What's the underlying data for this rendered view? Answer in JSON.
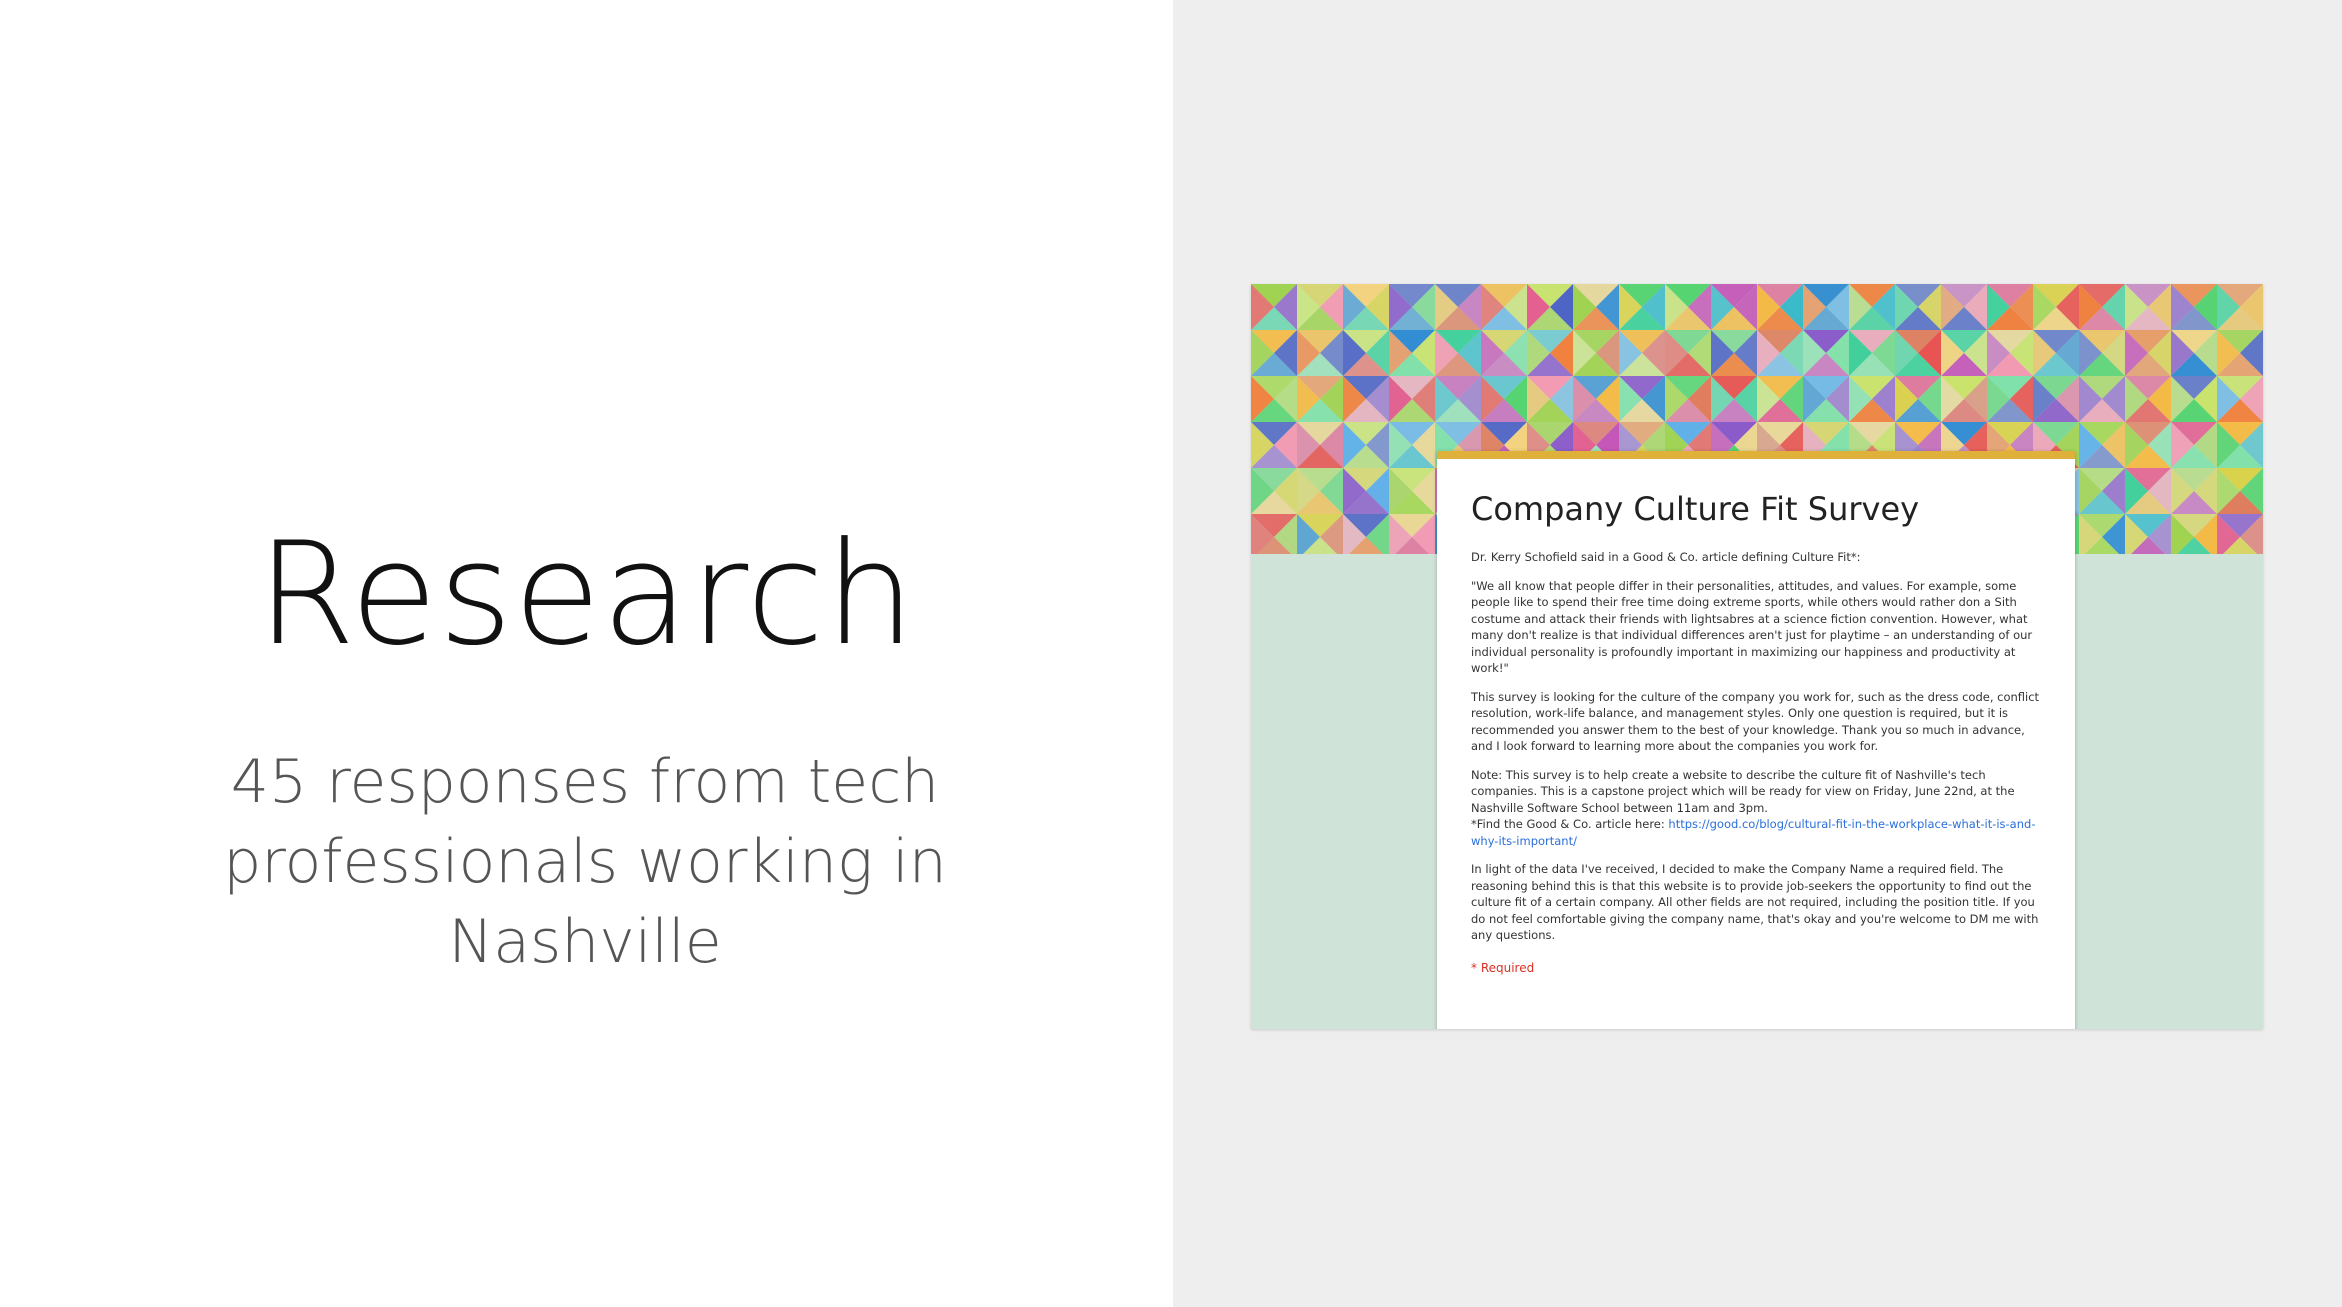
{
  "slide": {
    "title": "Research",
    "subtitle": "45 responses from tech professionals working in Nashville"
  },
  "form": {
    "title": "Company Culture Fit Survey",
    "intro": "Dr. Kerry Schofield said in a Good & Co. article defining Culture Fit*:",
    "quote": "\"We all know that people differ in their personalities, attitudes, and values. For example, some people like to spend their free time doing extreme sports, while others would rather don a Sith costume and attack their friends with lightsabres at a science fiction convention. However, what many don't realize is that individual differences aren't just for playtime – an understanding of our individual personality is profoundly important in maximizing our happiness and productivity at work!\"",
    "description": "This survey is looking for the culture of the company you work for, such as the dress code, conflict resolution, work-life balance, and management styles. Only one question is required, but it is recommended you answer them to the best of your knowledge. Thank you so much in advance, and I look forward to learning more about the companies you work for.",
    "note": "Note: This survey is to help create a website to describe the culture fit of Nashville's tech companies. This is a capstone project which will be ready for view on Friday, June 22nd, at the Nashville Software School between 11am and 3pm.",
    "article_prefix": "*Find the Good & Co. article here: ",
    "article_link": "https://good.co/blog/cultural-fit-in-the-workplace-what-it-is-and-why-its-important/",
    "update": "In light of the data I've received, I decided to make the Company Name a required field. The reasoning behind this is that this website is to provide job-seekers the opportunity to find out the culture fit of a certain company. All other fields are not required, including the position title. If you do not feel comfortable giving the company name, that's okay and you're welcome to DM me with any questions.",
    "required_label": "* Required",
    "accent_color": "#e0b13a",
    "background_color": "#cfe3d9"
  }
}
